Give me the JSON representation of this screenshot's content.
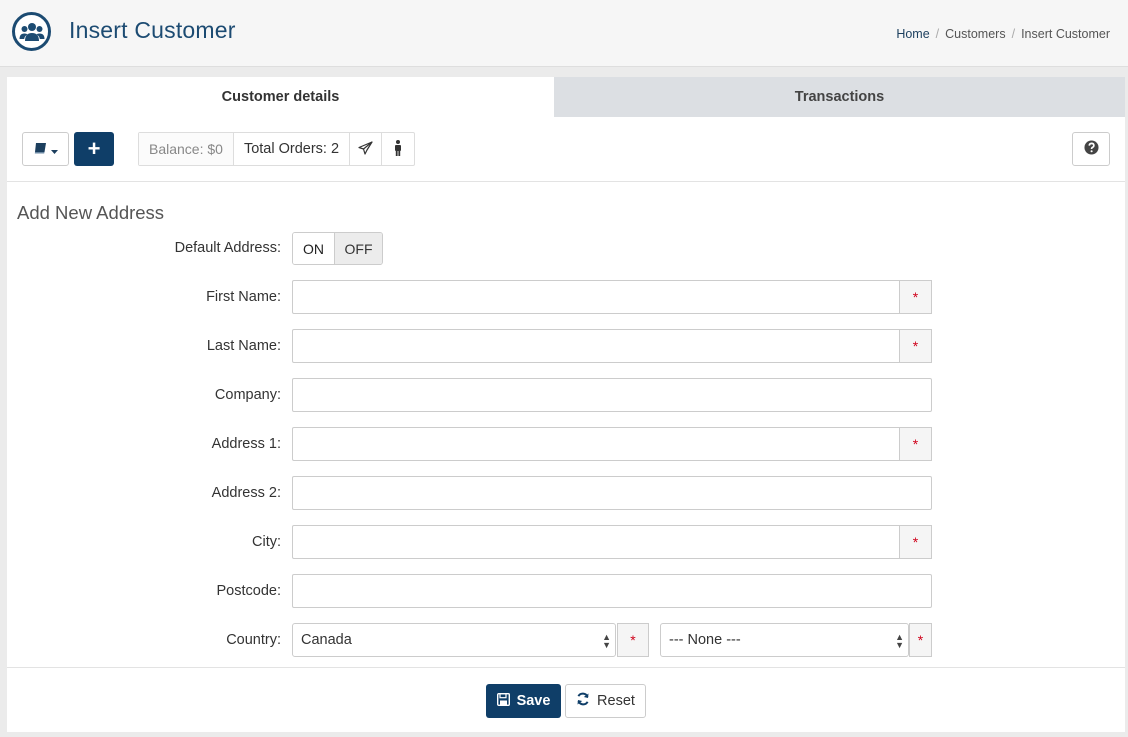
{
  "header": {
    "title": "Insert Customer",
    "breadcrumb": [
      "Home",
      "Customers",
      "Insert Customer"
    ],
    "breadcrumb_separator": "/"
  },
  "tabs": [
    {
      "label": "Customer details",
      "active": true
    },
    {
      "label": "Transactions",
      "active": false
    }
  ],
  "toolbar": {
    "add_icon": "+",
    "balance": "Balance: $0",
    "total_orders": "Total Orders: 2"
  },
  "form": {
    "section_title": "Add New Address",
    "default_address": {
      "label": "Default Address:",
      "on": "ON",
      "off": "OFF",
      "selected": "OFF"
    },
    "required_marker": "*",
    "fields": {
      "first_name": {
        "label": "First Name:",
        "value": "",
        "required": true
      },
      "last_name": {
        "label": "Last Name:",
        "value": "",
        "required": true
      },
      "company": {
        "label": "Company:",
        "value": "",
        "required": false
      },
      "address1": {
        "label": "Address 1:",
        "value": "",
        "required": true
      },
      "address2": {
        "label": "Address 2:",
        "value": "",
        "required": false
      },
      "city": {
        "label": "City:",
        "value": "",
        "required": true
      },
      "postcode": {
        "label": "Postcode:",
        "value": "",
        "required": false
      }
    },
    "country": {
      "label": "Country:",
      "selected": "Canada",
      "zone_selected": "--- None ---"
    }
  },
  "footer": {
    "save_label": "Save",
    "reset_label": "Reset"
  },
  "colors": {
    "primary": "#0f3e68",
    "title": "#1c4b72",
    "required": "#d0021b",
    "inactive_tab": "#dcdfe3"
  },
  "icons": {
    "app": "users-icon",
    "book": "book-icon",
    "send": "paper-plane-icon",
    "person": "male-icon",
    "help": "question-circle-icon",
    "save": "floppy-disk-icon",
    "reset": "refresh-icon"
  }
}
